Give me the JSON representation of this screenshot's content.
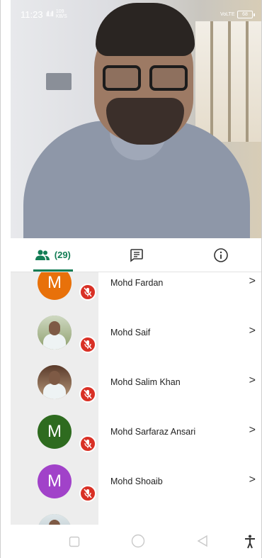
{
  "status_bar": {
    "time": "11:23",
    "signal_text": "ıll.ıll",
    "net_speed": "109 KB/S",
    "volte_label": "VoLTE",
    "battery_level": "68"
  },
  "tabs": [
    {
      "icon": "people-icon",
      "label": "(29)"
    },
    {
      "icon": "chat-icon",
      "label": ""
    },
    {
      "icon": "info-icon",
      "label": ""
    }
  ],
  "participants": [
    {
      "name": "Mohd Fardan",
      "initial": "M",
      "avatar_color": "#e8710a",
      "photo": false
    },
    {
      "name": "Mohd Saif",
      "initial": "",
      "avatar_color": "#9aa58a",
      "photo": true
    },
    {
      "name": "Mohd Salim Khan",
      "initial": "",
      "avatar_color": "#a88a6f",
      "photo": true
    },
    {
      "name": "Mohd Sarfaraz Ansari",
      "initial": "M",
      "avatar_color": "#2e6b1f",
      "photo": false
    },
    {
      "name": "Mohd Shoaib",
      "initial": "M",
      "avatar_color": "#a142c9",
      "photo": false
    }
  ],
  "colors": {
    "accent": "#137d55",
    "muted_mic": "#d93025"
  },
  "nav": [
    "square-recents-icon",
    "circle-home-icon",
    "triangle-back-icon",
    "accessibility-icon"
  ]
}
